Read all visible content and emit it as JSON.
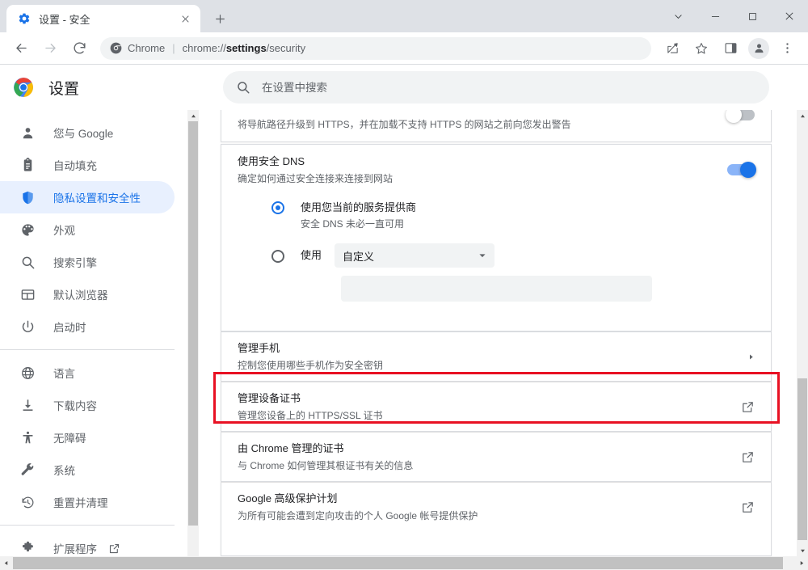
{
  "window": {
    "tab": {
      "title": "设置 - 安全",
      "favicon": "gear-icon",
      "close": "×"
    },
    "new_tab_label": "+",
    "controls": {
      "minimize": "—",
      "maximize": "□",
      "close": "✕",
      "tab_search": "⌄"
    }
  },
  "toolbar": {
    "back": "←",
    "forward": "→",
    "reload": "⟳",
    "omnibox": {
      "chrome_label": "Chrome",
      "separator": "|",
      "url_prefix": "chrome://",
      "url_bold": "settings",
      "url_suffix": "/security"
    },
    "share": "share-icon",
    "bookmark": "star-icon",
    "side_panel": "side-panel-icon",
    "profile": "profile-avatar",
    "menu": "three-dot-menu"
  },
  "settings_header": {
    "title": "设置",
    "search_placeholder": "在设置中搜索",
    "search_value": ""
  },
  "sidebar": {
    "groups": [
      {
        "items": [
          {
            "label": "您与 Google",
            "icon": "person-icon",
            "selected": false
          },
          {
            "label": "自动填充",
            "icon": "clipboard-icon",
            "selected": false
          },
          {
            "label": "隐私设置和安全性",
            "icon": "shield-icon",
            "selected": true
          },
          {
            "label": "外观",
            "icon": "palette-icon",
            "selected": false
          },
          {
            "label": "搜索引擎",
            "icon": "search-icon",
            "selected": false
          },
          {
            "label": "默认浏览器",
            "icon": "browser-window-icon",
            "selected": false
          },
          {
            "label": "启动时",
            "icon": "power-icon",
            "selected": false
          }
        ]
      },
      {
        "items": [
          {
            "label": "语言",
            "icon": "globe-icon",
            "selected": false
          },
          {
            "label": "下载内容",
            "icon": "download-icon",
            "selected": false
          },
          {
            "label": "无障碍",
            "icon": "accessibility-icon",
            "selected": false
          },
          {
            "label": "系统",
            "icon": "wrench-icon",
            "selected": false
          },
          {
            "label": "重置并清理",
            "icon": "history-restore-icon",
            "selected": false
          }
        ]
      },
      {
        "items": [
          {
            "label": "扩展程序",
            "icon": "puzzle-icon",
            "selected": false,
            "external": true
          }
        ]
      }
    ]
  },
  "main": {
    "https_row": {
      "subtitle": "将导航路径升级到 HTTPS，并在加载不支持 HTTPS 的网站之前向您发出警告",
      "toggle_state": "off"
    },
    "dns_section": {
      "title": "使用安全 DNS",
      "subtitle": "确定如何通过安全连接来连接到网站",
      "toggle_state": "on",
      "options": [
        {
          "label": "使用您当前的服务提供商",
          "sublabel": "安全 DNS 未必一直可用",
          "checked": true
        },
        {
          "label": "使用",
          "checked": false,
          "select_value": "自定义",
          "select_options": [
            "自定义"
          ],
          "custom_input_value": ""
        }
      ]
    },
    "rows": [
      {
        "title": "管理手机",
        "subtitle": "控制您使用哪些手机作为安全密钥",
        "control": "chevron-right",
        "highlighted": false
      },
      {
        "title": "管理设备证书",
        "subtitle": "管理您设备上的 HTTPS/SSL 证书",
        "control": "external-link",
        "highlighted": true
      },
      {
        "title": "由 Chrome 管理的证书",
        "subtitle": "与 Chrome 如何管理其根证书有关的信息",
        "control": "external-link",
        "highlighted": false
      },
      {
        "title": "Google 高级保护计划",
        "subtitle": "为所有可能会遭到定向攻击的个人 Google 帐号提供保护",
        "control": "external-link",
        "highlighted": false
      }
    ]
  },
  "colors": {
    "accent_blue": "#1a73e8",
    "toggle_on": "#8ab4f8",
    "highlight_red": "#e81123",
    "selected_bg": "#e8f0fe",
    "text_primary": "#202124",
    "text_secondary": "#5f6368"
  },
  "scrollbars": {
    "sidebar_vertical": {
      "up_arrow": "▲",
      "down_arrow": "▼"
    },
    "content_vertical": {
      "up_arrow": "▲",
      "down_arrow": "▼"
    },
    "horizontal": {
      "left_arrow": "◀",
      "right_arrow": "▶"
    }
  }
}
